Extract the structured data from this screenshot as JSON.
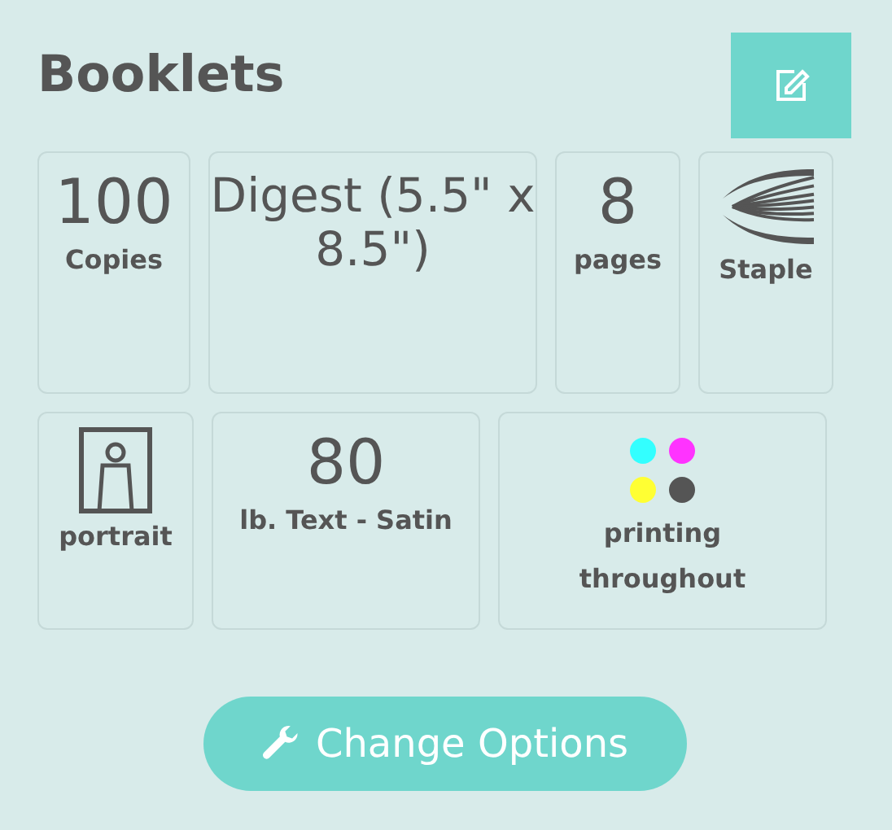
{
  "title": "Booklets",
  "rows": [
    [
      {
        "kind": "value",
        "value": "100",
        "label": "Copies"
      },
      {
        "kind": "value",
        "value": "Digest (5.5\" x 8.5\")"
      },
      {
        "kind": "value",
        "value": "8",
        "label": "pages"
      },
      {
        "kind": "staple",
        "label": "Staple"
      }
    ],
    [
      {
        "kind": "portrait",
        "label": "portrait"
      },
      {
        "kind": "value",
        "value": "80",
        "label": "lb. Text - Satin"
      },
      {
        "kind": "colors",
        "label": "printing throughout"
      }
    ]
  ],
  "button": "Change Options"
}
